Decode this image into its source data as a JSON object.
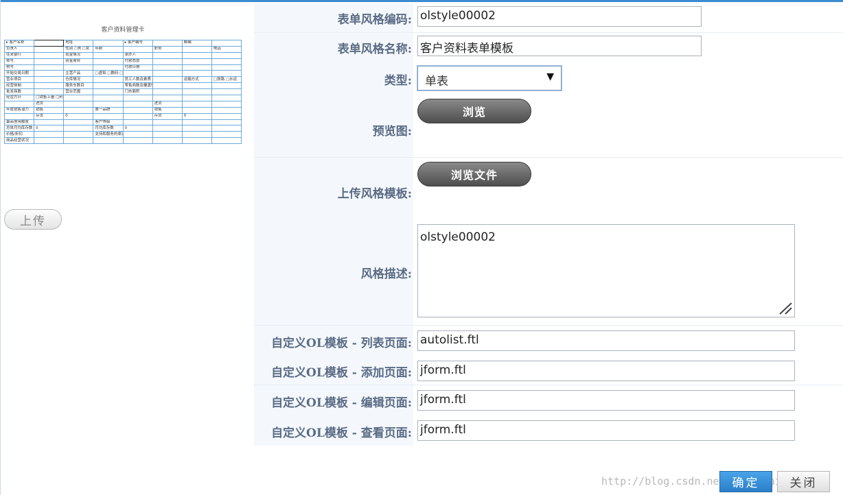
{
  "preview": {
    "title": "客户资料管理卡",
    "rows": [
      [
        "▸ 客户名称",
        "",
        "地址",
        "",
        "▸ 客户编号",
        "",
        "邮编",
        ""
      ],
      [
        "负责人",
        "",
        "性别  ○男 ○女",
        "年龄",
        "",
        "职务",
        "",
        "电话"
      ],
      [
        "往来银行",
        "",
        "现金情况",
        "",
        "承办人",
        "",
        "",
        ""
      ],
      [
        "账号",
        "",
        "资金周转",
        "",
        "付款态度",
        "",
        "",
        ""
      ],
      [
        "税号",
        "",
        "",
        "",
        "付款日期",
        "",
        "",
        ""
      ],
      [
        "开始交易日期",
        "",
        "主营产品",
        "□虚拟 □数码 □美容 □服装 □配饰",
        "",
        "",
        "",
        ""
      ],
      [
        "营业项目",
        "",
        "仓库情况",
        "",
        "员工人数及素质",
        "",
        "运输方式",
        "□铁路 □水运"
      ],
      [
        "经营体制",
        "",
        "服务车数目",
        "",
        "零售商数及覆盖情况",
        "",
        "",
        ""
      ],
      [
        "批发商数",
        "",
        "营业范围",
        "",
        "门市面积",
        "",
        "",
        ""
      ],
      [
        "经营方针",
        "□销售上量 □利润为准 □量利兼顾 □积极 □保守 □平常 □投机 □衰乱",
        "",
        "",
        "",
        "",
        "",
        ""
      ],
      [
        "",
        "进货",
        "",
        "",
        "",
        "进货",
        "",
        ""
      ],
      [
        "年度销售潜力",
        "销售",
        "",
        "第一品牌",
        "",
        "销售",
        "",
        ""
      ],
      [
        "",
        "存货",
        "0",
        "",
        "",
        "存货",
        "0",
        ""
      ],
      [
        "最高信用额度",
        "",
        "",
        "客户等级",
        "",
        "",
        "",
        ""
      ],
      [
        "总体月均库存数",
        "0",
        "",
        "月均库存数",
        "0",
        "",
        "",
        ""
      ],
      [
        "价格/折扣",
        "",
        "",
        "支持和服务的渠道",
        "",
        "",
        "",
        ""
      ],
      [
        "商品经营状况",
        "",
        "",
        "",
        "",
        "",
        "",
        ""
      ]
    ]
  },
  "upload_button": "上传",
  "form": {
    "code_label": "表单风格编码:",
    "code_value": "olstyle00002",
    "name_label": "表单风格名称:",
    "name_value": "客户资料表单模板",
    "type_label": "类型:",
    "type_value": "单表",
    "preview_label": "预览图:",
    "browse_button": "浏览",
    "upload_label": "上传风格模板:",
    "browse_file_button": "浏览文件",
    "desc_label": "风格描述:",
    "desc_value": "olstyle00002",
    "list_label": "自定义OL模板 - 列表页面:",
    "list_value": "autolist.ftl",
    "add_label": "自定义OL模板 - 添加页面:",
    "add_value": "jform.ftl",
    "edit_label": "自定义OL模板 - 编辑页面:",
    "edit_value": "jform.ftl",
    "view_label": "自定义OL模板 - 查看页面:",
    "view_value": "jform.ftl"
  },
  "footer": {
    "ok_button": "确定",
    "close_button": "关闭",
    "watermark": "http://blog.csdn.net/zhangdaiscott"
  }
}
